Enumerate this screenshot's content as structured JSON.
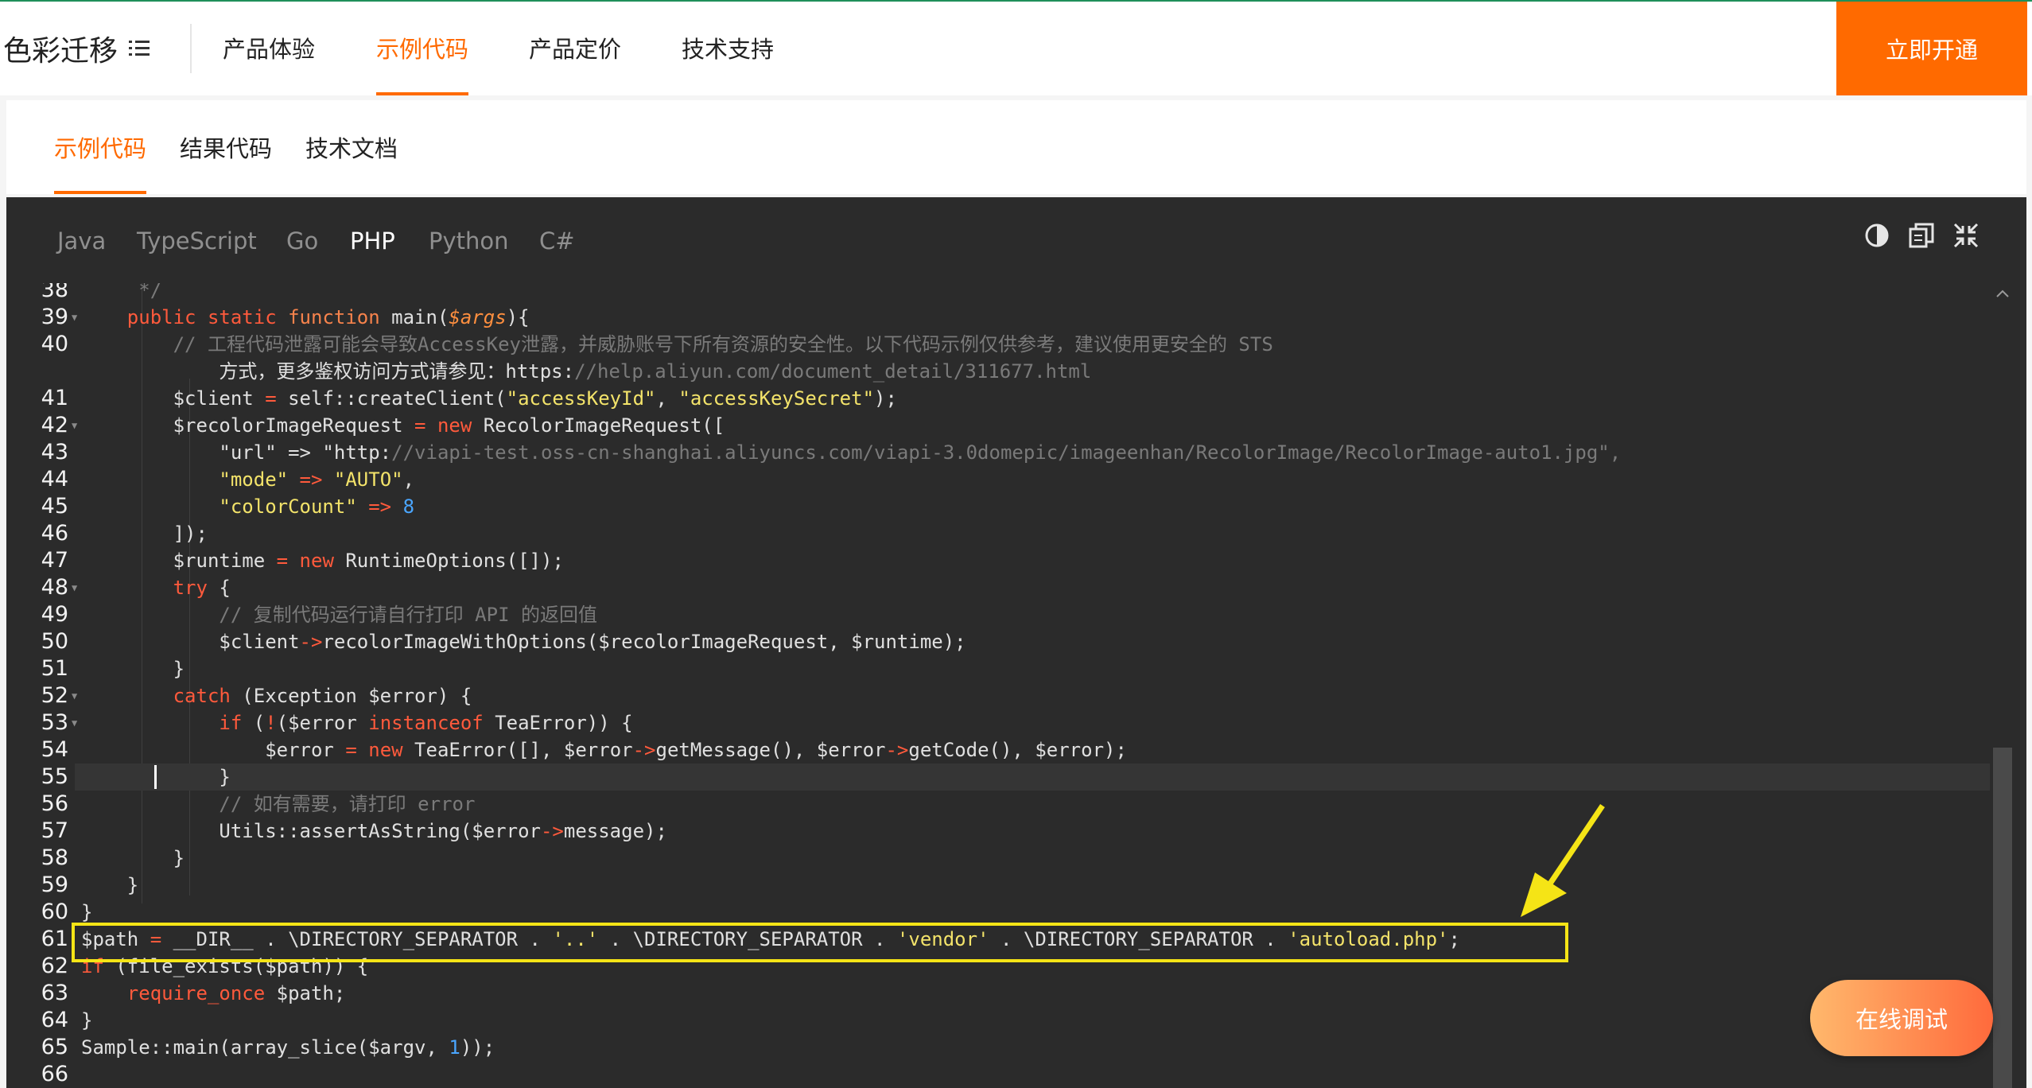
{
  "header": {
    "brand": "色彩迁移",
    "nav": [
      "产品体验",
      "示例代码",
      "产品定价",
      "技术支持"
    ],
    "active_nav": "示例代码",
    "cta": "立即开通"
  },
  "subtabs": [
    "示例代码",
    "结果代码",
    "技术文档"
  ],
  "languages": [
    "Java",
    "TypeScript",
    "Go",
    "PHP",
    "Python",
    "C#"
  ],
  "active_language": "PHP",
  "toolbar_icons": [
    "theme-toggle-icon",
    "copy-icon",
    "collapse-icon"
  ],
  "code_lines": [
    {
      "n": "38",
      "text": "     */"
    },
    {
      "n": "39",
      "text": "    public static function main($args){"
    },
    {
      "n": "40",
      "text": "        // 工程代码泄露可能会导致AccessKey泄露，并威胁账号下所有资源的安全性。以下代码示例仅供参考，建议使用更安全的 STS"
    },
    {
      "n": "",
      "text": "            方式，更多鉴权访问方式请参见：https://help.aliyun.com/document_detail/311677.html"
    },
    {
      "n": "41",
      "text": "        $client = self::createClient(\"accessKeyId\", \"accessKeySecret\");"
    },
    {
      "n": "42",
      "text": "        $recolorImageRequest = new RecolorImageRequest(["
    },
    {
      "n": "43",
      "text": "            \"url\" => \"http://viapi-test.oss-cn-shanghai.aliyuncs.com/viapi-3.0domepic/imageenhan/RecolorImage/RecolorImage-auto1.jpg\","
    },
    {
      "n": "44",
      "text": "            \"mode\" => \"AUTO\","
    },
    {
      "n": "45",
      "text": "            \"colorCount\" => 8"
    },
    {
      "n": "46",
      "text": "        ]);"
    },
    {
      "n": "47",
      "text": "        $runtime = new RuntimeOptions([]);"
    },
    {
      "n": "48",
      "text": "        try {"
    },
    {
      "n": "49",
      "text": "            // 复制代码运行请自行打印 API 的返回值"
    },
    {
      "n": "50",
      "text": "            $client->recolorImageWithOptions($recolorImageRequest, $runtime);"
    },
    {
      "n": "51",
      "text": "        }"
    },
    {
      "n": "52",
      "text": "        catch (Exception $error) {"
    },
    {
      "n": "53",
      "text": "            if (!($error instanceof TeaError)) {"
    },
    {
      "n": "54",
      "text": "                $error = new TeaError([], $error->getMessage(), $error->getCode(), $error);"
    },
    {
      "n": "55",
      "text": "            }"
    },
    {
      "n": "56",
      "text": "            // 如有需要，请打印 error"
    },
    {
      "n": "57",
      "text": "            Utils::assertAsString($error->message);"
    },
    {
      "n": "58",
      "text": "        }"
    },
    {
      "n": "59",
      "text": "    }"
    },
    {
      "n": "60",
      "text": "}"
    },
    {
      "n": "61",
      "text": "$path = __DIR__ . \\DIRECTORY_SEPARATOR . '..' . \\DIRECTORY_SEPARATOR . 'vendor' . \\DIRECTORY_SEPARATOR . 'autoload.php';"
    },
    {
      "n": "62",
      "text": "if (file_exists($path)) {"
    },
    {
      "n": "63",
      "text": "    require_once $path;"
    },
    {
      "n": "64",
      "text": "}"
    },
    {
      "n": "65",
      "text": "Sample::main(array_slice($argv, 1));"
    },
    {
      "n": "66",
      "text": ""
    }
  ],
  "debug_button": "在线调试",
  "colors": {
    "accent": "#ff6a00",
    "highlight": "#f5e416",
    "editor_bg": "#2b2b2b"
  }
}
